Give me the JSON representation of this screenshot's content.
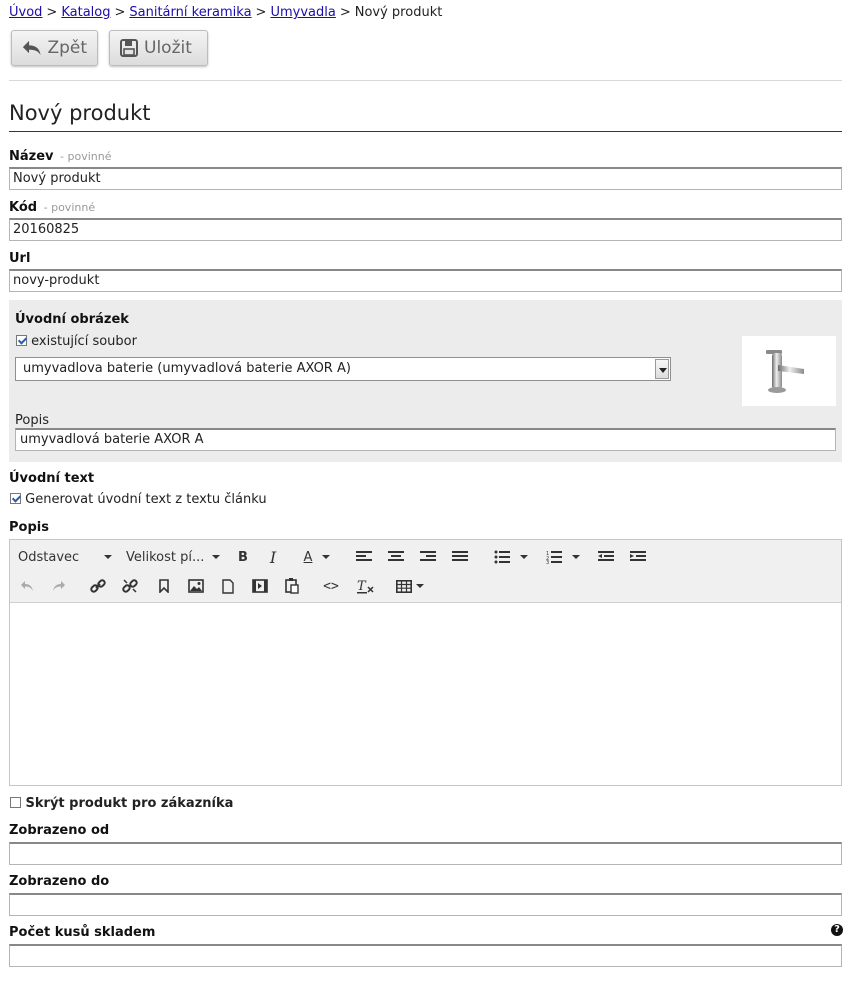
{
  "breadcrumb": {
    "items": [
      "Úvod",
      "Katalog",
      "Sanitární keramika",
      "Umyvadla"
    ],
    "current": "Nový produkt",
    "separator": ">"
  },
  "toolbar": {
    "back_label": "Zpět",
    "save_label": "Uložit"
  },
  "page_title": "Nový produkt",
  "form": {
    "required_hint": "- povinné",
    "name_label": "Název",
    "name_value": "Nový produkt",
    "code_label": "Kód",
    "code_value": "20160825",
    "url_label": "Url",
    "url_value": "novy-produkt",
    "intro_image": {
      "label": "Úvodní obrázek",
      "existing_file_label": "existující soubor",
      "existing_file_checked": true,
      "selected_file": "umyvadlova baterie (umyvadlová baterie AXOR A)",
      "description_label": "Popis",
      "description_value": "umyvadlová baterie AXOR A"
    },
    "intro_text_label": "Úvodní text",
    "generate_intro_label": "Generovat úvodní text z textu článku",
    "generate_intro_checked": true,
    "description_label": "Popis",
    "editor": {
      "format_select": "Odstavec",
      "size_select": "Velikost pí..."
    },
    "hide_product_label": "Skrýt produkt pro zákazníka",
    "hide_product_checked": false,
    "shown_from_label": "Zobrazeno od",
    "shown_from_value": "",
    "shown_to_label": "Zobrazeno do",
    "shown_to_value": "",
    "stock_label": "Počet kusů skladem",
    "stock_value": "",
    "help_icon_glyph": "?"
  }
}
